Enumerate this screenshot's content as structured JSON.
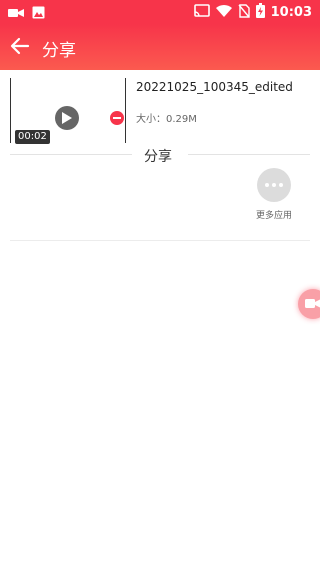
{
  "status_bar": {
    "time": "10:03",
    "icons_left": [
      "video-camera-icon",
      "image-icon"
    ],
    "icons_right": [
      "cast-icon",
      "wifi-icon",
      "no-sim-icon",
      "battery-charging-icon"
    ]
  },
  "app_bar": {
    "title": "分享",
    "back_icon": "back-arrow-icon"
  },
  "video": {
    "filename": "20221025_100345_edited",
    "size": "大小：0.29M",
    "duration": "00:02"
  },
  "share": {
    "section_title": "分享",
    "more_apps_label": "更多应用"
  },
  "colors": {
    "accent": "#f7344a",
    "accent_light": "#fb5a4f"
  }
}
